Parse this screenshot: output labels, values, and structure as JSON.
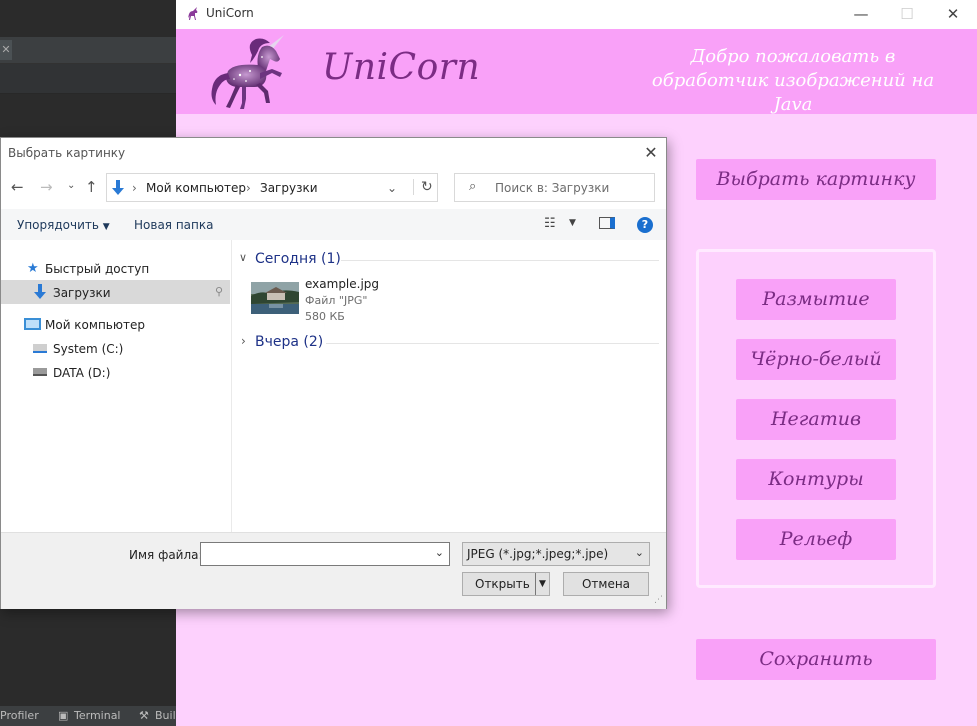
{
  "ide": {
    "bottom_tabs": [
      "Profiler",
      "Terminal",
      "Buil"
    ]
  },
  "app": {
    "window_title": "UniCorn",
    "name": "UniCorn",
    "welcome": "Добро пожаловать в обработчик изображений на Java",
    "choose_button": "Выбрать картинку",
    "filters": [
      "Размытие",
      "Чёрно-белый",
      "Негатив",
      "Контуры",
      "Рельеф"
    ],
    "save_button": "Сохранить"
  },
  "dialog": {
    "title": "Выбрать картинку",
    "breadcrumb": [
      "Мой компьютер",
      "Загрузки"
    ],
    "search_placeholder": "Поиск в: Загрузки",
    "toolbar": {
      "organize": "Упорядочить",
      "new_folder": "Новая папка"
    },
    "nav": {
      "quick_access": "Быстрый доступ",
      "downloads": "Загрузки",
      "my_computer": "Мой компьютер",
      "drives": [
        "System (C:)",
        "DATA (D:)"
      ]
    },
    "groups": [
      {
        "label": "Сегодня (1)",
        "expanded": true
      },
      {
        "label": "Вчера (2)",
        "expanded": false
      }
    ],
    "file": {
      "name": "example.jpg",
      "type": "Файл \"JPG\"",
      "size": "580 КБ"
    },
    "filename_label": "Имя файла:",
    "filename_value": "",
    "file_type": "JPEG (*.jpg;*.jpeg;*.jpe)",
    "open_button": "Открыть",
    "cancel_button": "Отмена"
  },
  "colors": {
    "app_bg": "#fdd1fd",
    "header_bg": "#f9a1f8",
    "accent_text": "#7b2c84",
    "ide_bg": "#2b2b2b"
  }
}
